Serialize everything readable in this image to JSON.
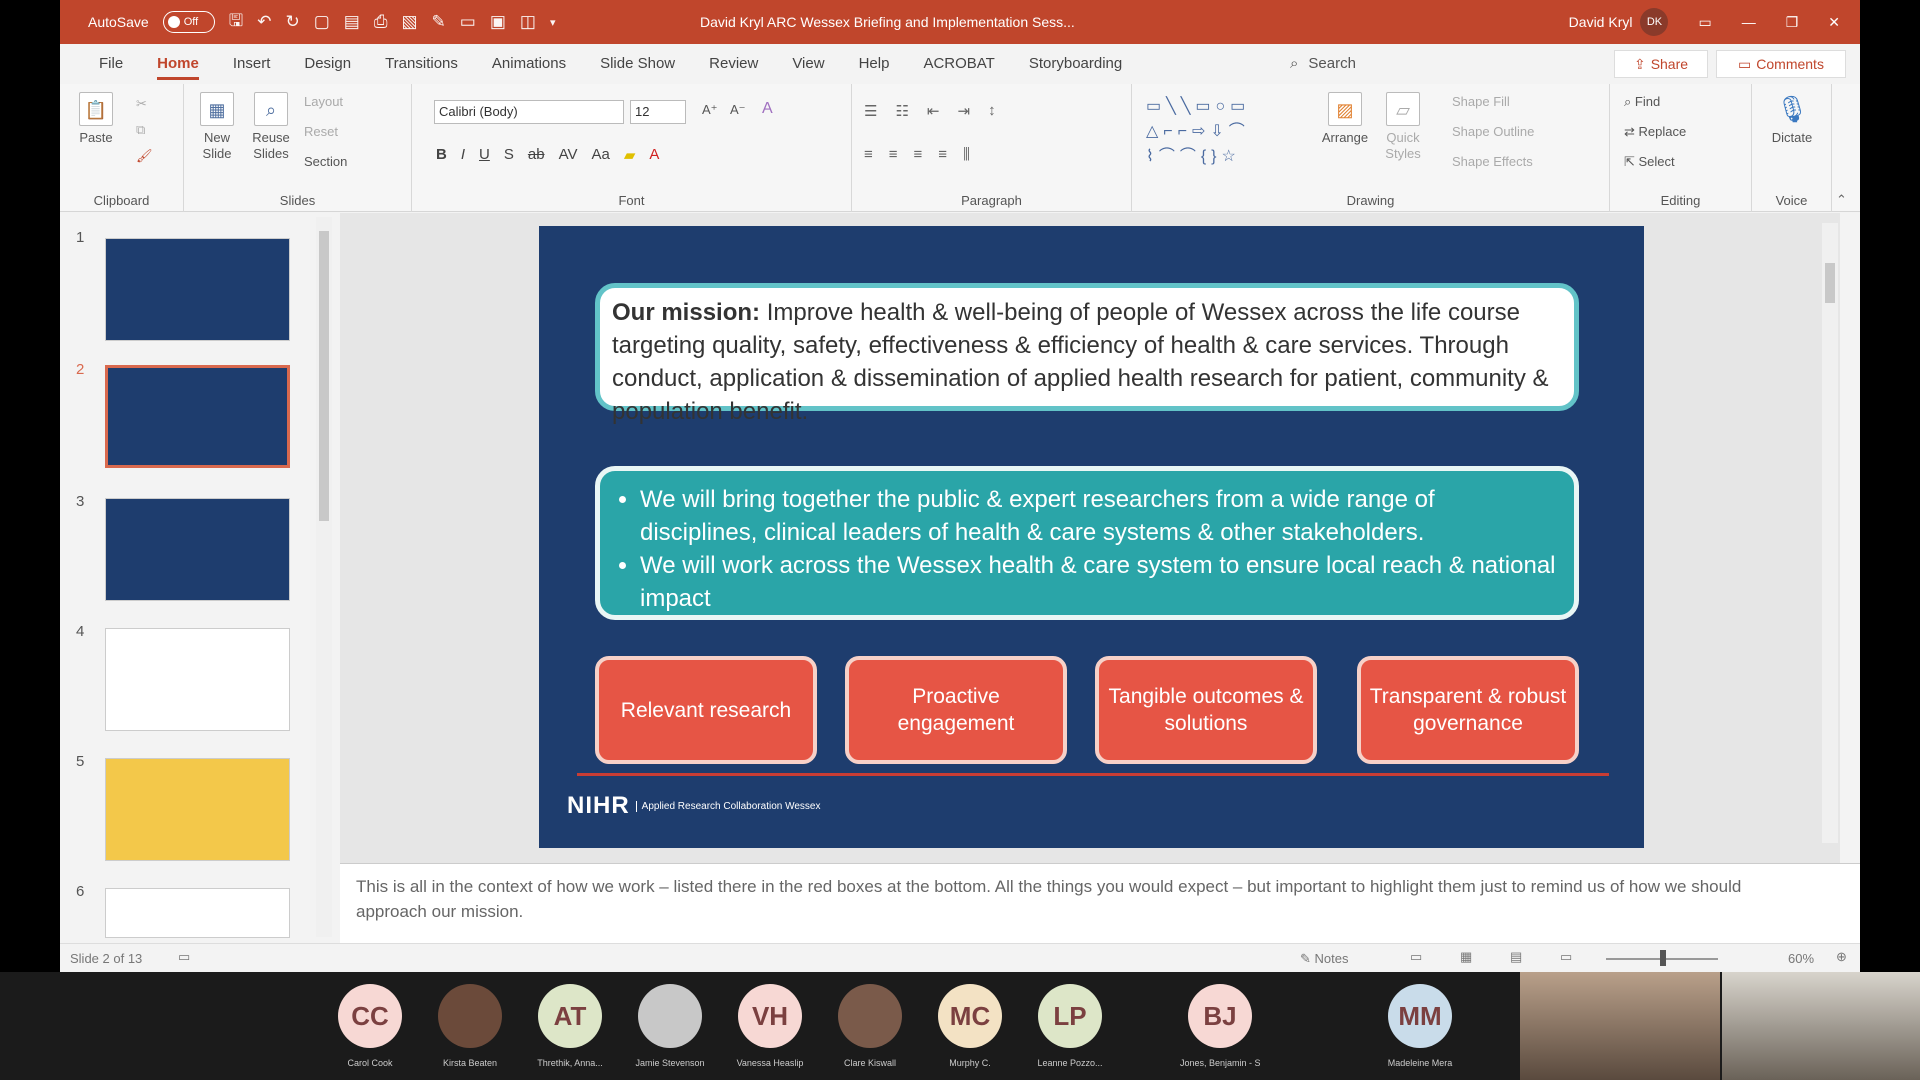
{
  "titlebar": {
    "autosave_label": "AutoSave",
    "autosave_state": "Off",
    "doc_title": "David Kryl ARC Wessex Briefing and Implementation Sess...",
    "user_name": "David Kryl",
    "user_initials": "DK"
  },
  "menu": {
    "tabs": [
      "File",
      "Home",
      "Insert",
      "Design",
      "Transitions",
      "Animations",
      "Slide Show",
      "Review",
      "View",
      "Help",
      "ACROBAT",
      "Storyboarding"
    ],
    "active_tab": "Home",
    "search_label": "Search",
    "share_label": "Share",
    "comments_label": "Comments"
  },
  "ribbon": {
    "clipboard": {
      "label": "Clipboard",
      "paste": "Paste"
    },
    "slides": {
      "label": "Slides",
      "new_slide": "New Slide",
      "reuse_slides": "Reuse Slides",
      "layout": "Layout",
      "reset": "Reset",
      "section": "Section"
    },
    "font": {
      "label": "Font",
      "font_name": "Calibri (Body)",
      "font_size": "12"
    },
    "paragraph": {
      "label": "Paragraph"
    },
    "drawing": {
      "label": "Drawing",
      "arrange": "Arrange",
      "quick_styles": "Quick Styles",
      "shape_fill": "Shape Fill",
      "shape_outline": "Shape Outline",
      "shape_effects": "Shape Effects"
    },
    "editing": {
      "label": "Editing",
      "find": "Find",
      "replace": "Replace",
      "select": "Select"
    },
    "voice": {
      "label": "Voice",
      "dictate": "Dictate"
    }
  },
  "thumbnails": [
    "1",
    "2",
    "3",
    "4",
    "5",
    "6"
  ],
  "selected_thumbnail": 2,
  "slide": {
    "mission_label": "Our mission:",
    "mission_text": "Improve health & well-being of people of Wessex across the life course targeting quality, safety, effectiveness & efficiency of health & care services. Through conduct, application & dissemination of applied health research for patient, community & population benefit.",
    "bullets": [
      "We will bring together the public & expert researchers from a wide range of disciplines, clinical leaders of health & care systems & other stakeholders.",
      "We will work across the Wessex health & care system to ensure local reach & national impact"
    ],
    "boxes": [
      "Relevant research",
      "Proactive engagement",
      "Tangible outcomes & solutions",
      "Transparent & robust governance"
    ],
    "logo_text": "NIHR",
    "logo_sub": "Applied Research Collaboration Wessex"
  },
  "notes_text": "This is all in the context of how we work – listed there in the red boxes at the bottom. All the things you would expect – but important to highlight them just to remind us of how we should approach our mission.",
  "status": {
    "slide_count": "Slide 2 of 13",
    "notes_label": "Notes",
    "zoom": "60%"
  },
  "participants": [
    {
      "initials": "CC",
      "name": "Carol Cook",
      "bg": "#f7d8d4"
    },
    {
      "initials": "",
      "name": "Kirsta Beaten",
      "bg": "#6b4a3a"
    },
    {
      "initials": "AT",
      "name": "Threthik, Anna...",
      "bg": "#dde6c8"
    },
    {
      "initials": "",
      "name": "Jamie Stevenson",
      "bg": "#c8c8c8"
    },
    {
      "initials": "VH",
      "name": "Vanessa Heaslip",
      "bg": "#f7d8d4"
    },
    {
      "initials": "",
      "name": "Clare Kiswall",
      "bg": "#7a5a4a"
    },
    {
      "initials": "MC",
      "name": "Murphy C.",
      "bg": "#f3e2c4"
    },
    {
      "initials": "LP",
      "name": "Leanne Pozzo...",
      "bg": "#dde6c8"
    },
    {
      "initials": "BJ",
      "name": "Jones, Benjamin - Specialist Pediatric...",
      "bg": "#f7d8d4"
    },
    {
      "initials": "MM",
      "name": "Madeleine Mera",
      "bg": "#c9dcea"
    }
  ]
}
